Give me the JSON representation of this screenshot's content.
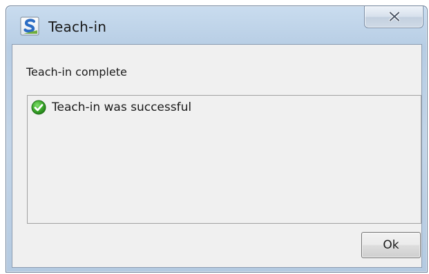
{
  "window": {
    "title": "Teach-in",
    "app_icon": "app-s-logo-icon",
    "close_icon": "close-icon"
  },
  "content": {
    "heading": "Teach-in complete",
    "result": {
      "icon": "success-check-icon",
      "message": "Teach-in was successful"
    }
  },
  "buttons": {
    "ok_label": "Ok"
  },
  "colors": {
    "frame": "#c3d5e8",
    "client_bg": "#f0f0f0",
    "success_green": "#3aa52a",
    "logo_blue": "#2b6cc4"
  }
}
